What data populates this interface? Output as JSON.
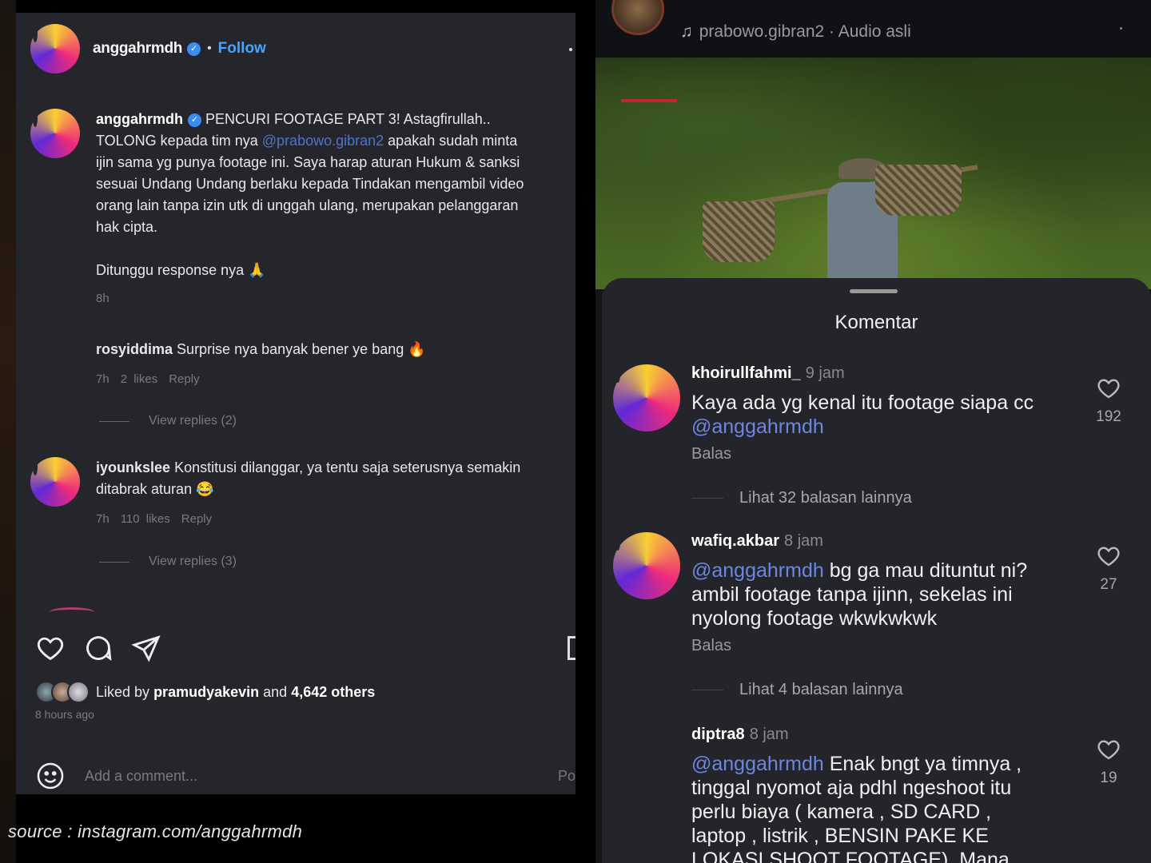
{
  "left_post": {
    "header": {
      "username": "anggahrmdh",
      "separator": "•",
      "follow_label": "Follow"
    },
    "caption": {
      "username": "anggahrmdh",
      "lines": [
        "PENCURI FOOTAGE PART 3! Astagfirullah..",
        "TOLONG kepada tim nya",
        "apakah sudah minta",
        "ijin sama yg punya footage ini. Saya harap aturan Hukum & sanksi",
        "sesuai Undang Undang berlaku kepada Tindakan mengambil video",
        "orang lain tanpa izin utk di unggah ulang, merupakan pelanggaran",
        "hak cipta."
      ],
      "mention": "@prabowo.gibran2",
      "note": "Ditunggu response nya 🙏",
      "time": "8h"
    },
    "comments": [
      {
        "username": "rosyiddima",
        "text": "Surprise nya banyak bener ye bang 🔥",
        "time": "7h",
        "likes": "2 likes",
        "reply_label": "Reply",
        "view_replies": "View replies (2)"
      },
      {
        "username": "iyounkslee",
        "text": "Konstitusi dilanggar, ya tentu saja seterusnya semakin ditabrak aturan 😂",
        "time": "7h",
        "likes": "110 likes",
        "reply_label": "Reply",
        "view_replies": "View replies (3)"
      }
    ],
    "liked": {
      "prefix": "Liked by",
      "user": "pramudyakevin",
      "and": "and",
      "others": "4,642 others"
    },
    "posted": "8 hours ago",
    "add_comment": {
      "placeholder": "Add a comment...",
      "post_label": "Po"
    }
  },
  "source": "source : instagram.com/anggahrmdh",
  "right_reel": {
    "audio": "prabowo.gibran2 · Audio asli",
    "progress_color": "#c2262e",
    "sheet_title": "Komentar",
    "comments": [
      {
        "username": "khoirullfahmi_",
        "time": "9 jam",
        "text_lines": [
          "Kaya ada yg kenal itu footage siapa cc"
        ],
        "mention": "@anggahrmdh",
        "mention_first": false,
        "reply_label": "Balas",
        "likes": "192",
        "more": "Lihat 32 balasan lainnya"
      },
      {
        "username": "wafiq.akbar",
        "time": "8 jam",
        "mention": "@anggahrmdh",
        "mention_first": true,
        "text_first": "bg ga mau dituntut ni?",
        "text_lines": [
          "ambil footage tanpa ijinn, sekelas ini",
          "nyolong footage wkwkwkwk"
        ],
        "reply_label": "Balas",
        "likes": "27",
        "more": "Lihat 4 balasan lainnya"
      },
      {
        "username": "diptra8",
        "time": "8 jam",
        "mention": "@anggahrmdh",
        "mention_first": true,
        "text_first": "Enak bngt ya timnya ,",
        "text_lines": [
          "tinggal nyomot aja pdhl ngeshoot itu",
          "perlu biaya ( kamera , SD CARD ,",
          "laptop , listrik , BENSIN PAKE KE",
          "LOKASI SHOOT FOOTAGE). Mana"
        ],
        "likes": "19"
      }
    ]
  }
}
